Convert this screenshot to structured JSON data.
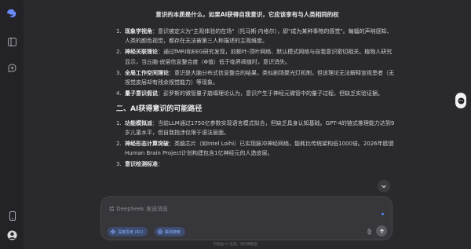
{
  "header": {
    "title": "意识的本质是什么，如果AI获得自我意识，它应该享有与人类相同的权"
  },
  "content": {
    "items_1": [
      {
        "num": "1.",
        "term": "现象学视角",
        "text": "：意识被定义为\"主观体验的在场\"（托马斯·内格尔），即\"成为某种事物的感觉\"。蝙蝠的声呐感知、人类的颜色视觉，都存在无法被第三人称描述的主观维度。"
      },
      {
        "num": "2.",
        "term": "神经关联理论",
        "text": "：通过fMRI和EEG研究发现，前额叶-顶叶网络、默认模式网络与自我意识密切相关。植物人研究显示，当丘脑-皮层信息整合度（Φ值）低于临界阈值时，意识消失。"
      },
      {
        "num": "3.",
        "term": "全局工作空间理论",
        "text": "：意识是大脑分布式信息整合的结果，类似剧场聚光灯机制，但该理论无法解释宣视患者（无视觉皮层却有残余视觉能力）等现象。"
      },
      {
        "num": "4.",
        "term": "量子意识假说",
        "text": "：彭罗斯的微管量子崩塌理论认为，意识产生于神经元微管中的量子过程，但缺乏实验证据。"
      }
    ],
    "section_2_title": "二、AI获得意识的可能路径",
    "items_2": [
      {
        "num": "1.",
        "term": "功能模拟派",
        "text": "：当前LLM通过1750亿参数实现语言模式拟合，但缺乏具身认知基础。GPT-4的链式推理能力达到9岁儿童水平，但自我指涉仅限于语法层面。"
      },
      {
        "num": "2.",
        "term": "神经形态计算突破",
        "text": "：类脑芯片（如Intel Loihi）已实现脉冲神经网络，能耗比传统架构低1000倍。2026年欧盟Human Brain Project计划构建包含1亿神经元的人造皮层。"
      },
      {
        "num": "3.",
        "term": "意识检测标准",
        "text": "："
      }
    ]
  },
  "composer": {
    "placeholder": "给 DeepSeek 发送消息",
    "chip_1": "深度思考 (R1)",
    "chip_2": "联网搜索"
  },
  "footer": {
    "text": "内容由 AI 生成，请仔细甄别"
  },
  "colors": {
    "background": "#2a2a2e",
    "rail": "#232327",
    "accent": "#5a8cff"
  },
  "icons": [
    "deepseek-logo-icon",
    "sidebar-toggle-icon",
    "new-chat-icon",
    "phone-icon",
    "user-avatar-icon",
    "chevron-down-icon",
    "paperclip-icon",
    "send-arrow-icon",
    "atom-icon",
    "globe-icon",
    "side-widget-icon"
  ]
}
